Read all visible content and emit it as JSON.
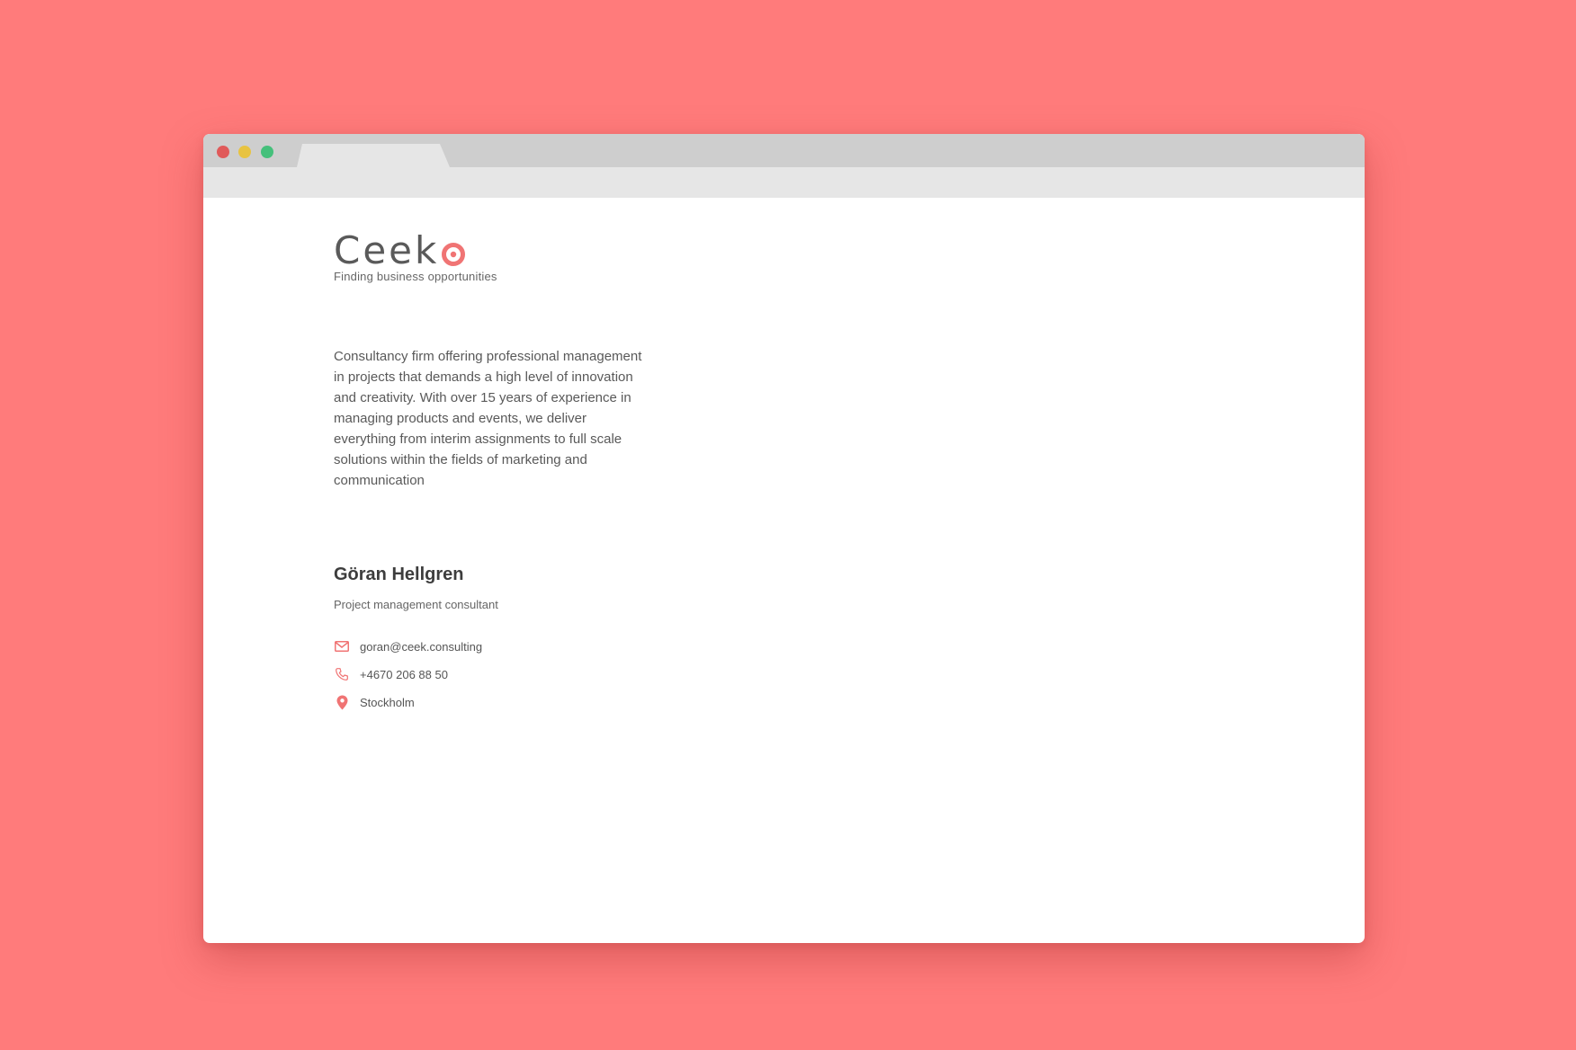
{
  "colors": {
    "background": "#ff7b7b",
    "accent": "#f07474",
    "window_red": "#e05a5a",
    "window_yellow": "#e8c341",
    "window_green": "#45c07b"
  },
  "browser": {
    "tab_label": ""
  },
  "brand": {
    "logo_text": "Ceek",
    "logo_mark_icon": "target-icon",
    "tagline": "Finding business opportunities"
  },
  "description": "Consultancy firm offering professional management in projects that demands a high level of innovation and creativity. With over 15 years of experience in managing products and events, we deliver everything from interim assignments to full scale solutions within the fields of marketing and communication",
  "person": {
    "name": "Göran Hellgren",
    "role": "Project management consultant"
  },
  "contacts": [
    {
      "icon": "envelope-icon",
      "text": "goran@ceek.consulting"
    },
    {
      "icon": "phone-icon",
      "text": "+4670 206 88 50"
    },
    {
      "icon": "map-pin-icon",
      "text": "Stockholm"
    }
  ]
}
